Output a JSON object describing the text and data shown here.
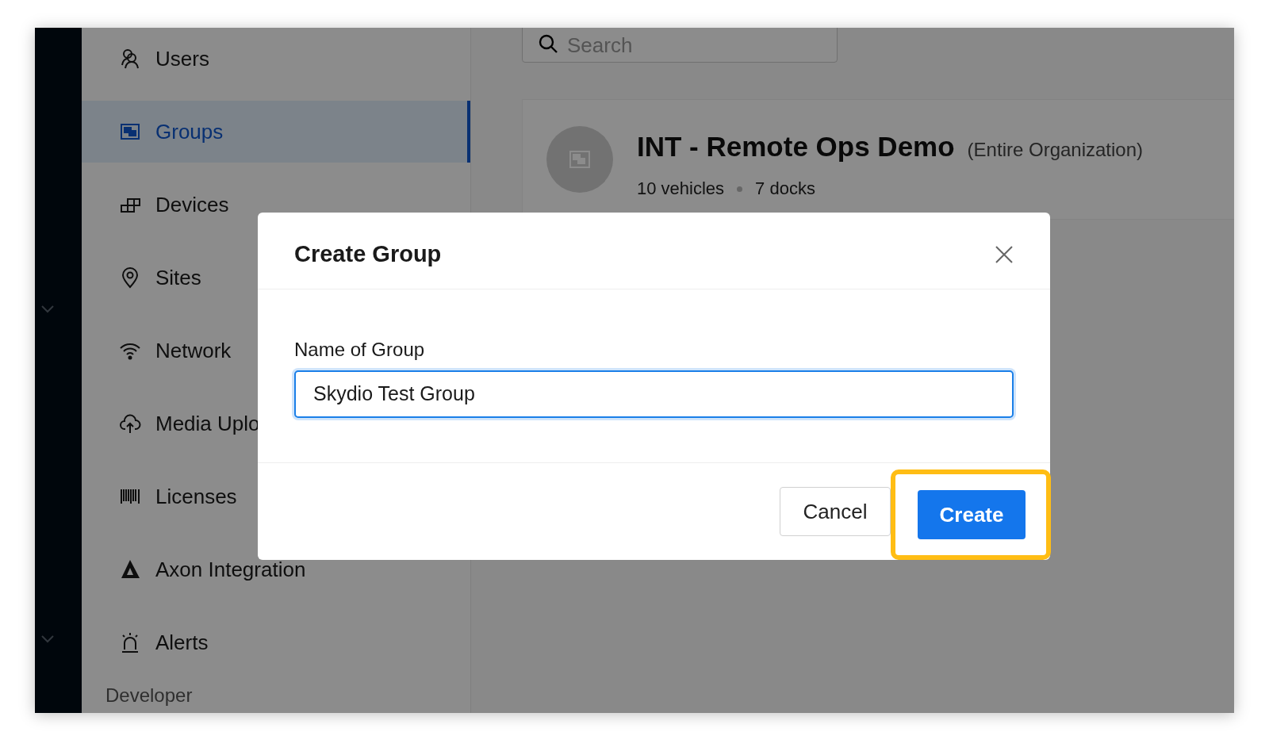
{
  "sidebar": {
    "items": [
      {
        "label": "Users",
        "kind": "users",
        "selected": false
      },
      {
        "label": "Groups",
        "kind": "groups",
        "selected": true
      },
      {
        "label": "Devices",
        "kind": "devices",
        "selected": false
      },
      {
        "label": "Sites",
        "kind": "sites",
        "selected": false
      },
      {
        "label": "Network",
        "kind": "network",
        "selected": false
      },
      {
        "label": "Media Uplo",
        "kind": "upload",
        "selected": false
      },
      {
        "label": "Licenses",
        "kind": "licenses",
        "selected": false
      },
      {
        "label": "Axon Integration",
        "kind": "axon",
        "selected": false
      },
      {
        "label": "Alerts",
        "kind": "alerts",
        "selected": false
      }
    ],
    "section_heading": "Developer"
  },
  "search": {
    "placeholder": "Search"
  },
  "group_card": {
    "title": "INT - Remote Ops Demo",
    "scope": "(Entire Organization)",
    "stats": [
      "10 vehicles",
      "7 docks"
    ]
  },
  "dialog": {
    "title": "Create Group",
    "field_label": "Name of Group",
    "field_value": "Skydio Test Group",
    "buttons": [
      {
        "label": "Cancel",
        "kind": "secondary",
        "highlighted": false
      },
      {
        "label": "Create",
        "kind": "primary",
        "highlighted": true
      }
    ]
  }
}
